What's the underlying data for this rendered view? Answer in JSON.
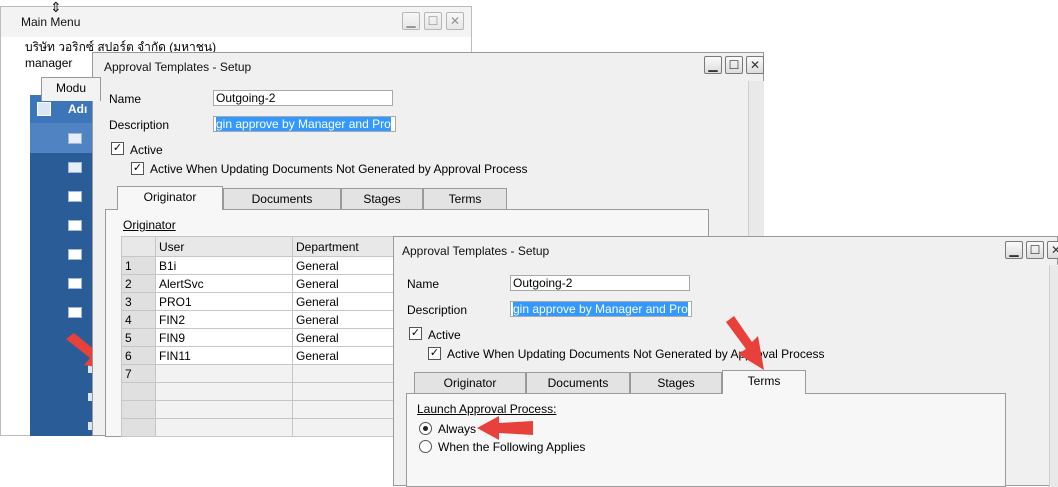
{
  "main_menu": {
    "title": "Main Menu",
    "company": "บริษัท วอริกซ์ สปอร์ต จำกัด (มหาชน)",
    "user": "manager",
    "tab": "Modu",
    "sidebar_header": "Adı"
  },
  "window_back": {
    "title": "Approval Templates - Setup",
    "name_label": "Name",
    "name_value": "Outgoing-2",
    "desc_label": "Description",
    "desc_value": "gin approve by Manager and Pro",
    "active_label": "Active",
    "active_update_label": "Active When Updating Documents Not Generated by Approval Process",
    "tabs": [
      "Originator",
      "Documents",
      "Stages",
      "Terms"
    ],
    "section_title": "Originator",
    "grid_headers": [
      "",
      "User",
      "Department"
    ],
    "grid_rows": [
      [
        "1",
        "B1i",
        "General"
      ],
      [
        "2",
        "AlertSvc",
        "General"
      ],
      [
        "3",
        "PRO1",
        "General"
      ],
      [
        "4",
        "FIN2",
        "General"
      ],
      [
        "5",
        "FIN9",
        "General"
      ],
      [
        "6",
        "FIN11",
        "General"
      ],
      [
        "7",
        "",
        ""
      ]
    ]
  },
  "window_front": {
    "title": "Approval Templates - Setup",
    "name_label": "Name",
    "name_value": "Outgoing-2",
    "desc_label": "Description",
    "desc_value": "gin approve by Manager and Pro",
    "active_label": "Active",
    "active_update_label": "Active When Updating Documents Not Generated by Approval Process",
    "tabs": [
      "Originator",
      "Documents",
      "Stages",
      "Terms"
    ],
    "launch_title": "Launch Approval Process:",
    "radio_always": "Always",
    "radio_when": "When the Following Applies"
  },
  "colors": {
    "arrow": "#e8413c",
    "sidebar": "#2a5d98",
    "selection": "#3399ff"
  }
}
